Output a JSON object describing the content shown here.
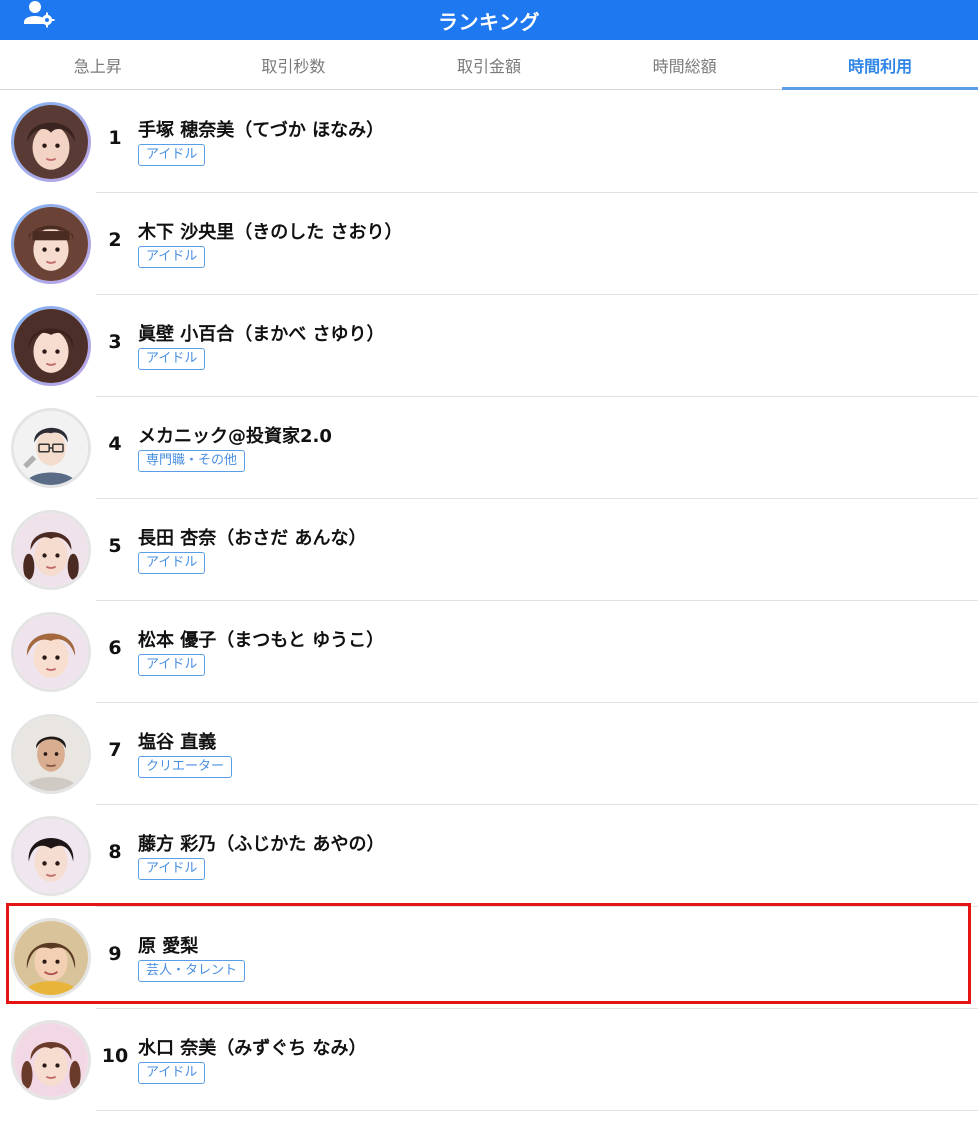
{
  "header": {
    "title": "ランキング",
    "icon": "user-settings-icon",
    "bg_color": "#1E78F0"
  },
  "tabs": [
    {
      "label": "急上昇",
      "active": false
    },
    {
      "label": "取引秒数",
      "active": false
    },
    {
      "label": "取引金額",
      "active": false
    },
    {
      "label": "時間総額",
      "active": false
    },
    {
      "label": "時間利用",
      "active": true
    }
  ],
  "ranking": [
    {
      "rank": "1",
      "name": "手塚 穂奈美（てづか ほなみ）",
      "tag": "アイドル",
      "avatar": "idol-photo-avatar",
      "ring": true
    },
    {
      "rank": "2",
      "name": "木下 沙央里（きのした さおり）",
      "tag": "アイドル",
      "avatar": "idol-photo-avatar",
      "ring": true
    },
    {
      "rank": "3",
      "name": "眞壁 小百合（まかべ さゆり）",
      "tag": "アイドル",
      "avatar": "idol-photo-avatar",
      "ring": true
    },
    {
      "rank": "4",
      "name": "メカニック@投資家2.0",
      "tag": "専門職・その他",
      "avatar": "illustrated-man-avatar",
      "ring": false
    },
    {
      "rank": "5",
      "name": "長田 杏奈（おさだ あんな）",
      "tag": "アイドル",
      "avatar": "idol-photo-avatar",
      "ring": false
    },
    {
      "rank": "6",
      "name": "松本 優子（まつもと ゆうこ）",
      "tag": "アイドル",
      "avatar": "idol-photo-avatar",
      "ring": false
    },
    {
      "rank": "7",
      "name": "塩谷 直義",
      "tag": "クリエーター",
      "avatar": "man-photo-avatar",
      "ring": false
    },
    {
      "rank": "8",
      "name": "藤方 彩乃（ふじかた あやの）",
      "tag": "アイドル",
      "avatar": "idol-photo-avatar",
      "ring": false
    },
    {
      "rank": "9",
      "name": "原 愛梨",
      "tag": "芸人・タレント",
      "avatar": "woman-photo-avatar",
      "ring": false,
      "highlighted": true
    },
    {
      "rank": "10",
      "name": "水口 奈美（みずぐち なみ）",
      "tag": "アイドル",
      "avatar": "idol-photo-avatar",
      "ring": false
    }
  ],
  "colors": {
    "accent": "#2f86e6",
    "tag_border": "#5b9ee8",
    "highlight": "#e41414"
  }
}
